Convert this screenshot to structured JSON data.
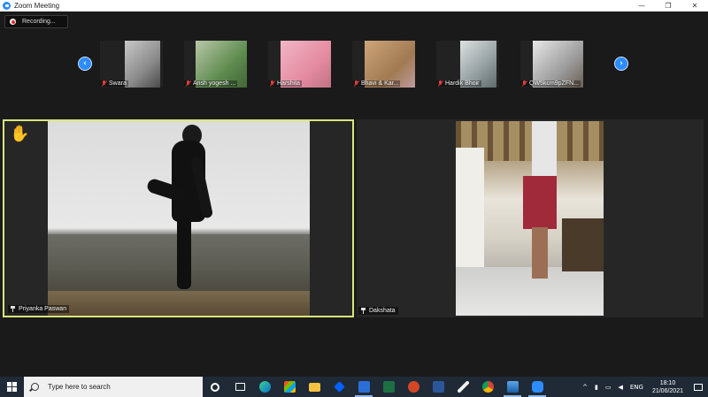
{
  "window": {
    "title": "Zoom Meeting",
    "controls": {
      "minimize": "—",
      "restore": "❐",
      "close": "✕"
    }
  },
  "recording": {
    "label": "Recording..."
  },
  "strip": {
    "prev_icon": "‹",
    "next_icon": "›",
    "thumbnails": [
      {
        "name": "Swara",
        "muted": true
      },
      {
        "name": "Ansh yogesh ...",
        "muted": true
      },
      {
        "name": "Harshita",
        "muted": true
      },
      {
        "name": "Bhavi & Kar...",
        "muted": true
      },
      {
        "name": "Hardik Bhoir",
        "muted": true
      },
      {
        "name": "QW5kcm9pZFN...",
        "muted": true
      }
    ]
  },
  "main": {
    "spotlight": {
      "name": "Priyanka Paswan",
      "raise_hand_icon": "✋",
      "active_speaker_color": "#d8e77a"
    },
    "second": {
      "name": "Dakshata"
    }
  },
  "taskbar": {
    "search_placeholder": "Type here to search",
    "apps": [
      "cortana",
      "task-view",
      "edge",
      "store",
      "file-explorer",
      "dropbox",
      "excel",
      "powerpoint",
      "word",
      "winamp",
      "chrome",
      "photos",
      "zoom"
    ],
    "tray": {
      "chevron": "^",
      "language": "ENG",
      "time": "18:10",
      "date": "21/06/2021"
    }
  },
  "colors": {
    "zoom_blue": "#2d8cff",
    "taskbar": "#1f2a36",
    "meeting_bg": "#1a1a1a"
  }
}
